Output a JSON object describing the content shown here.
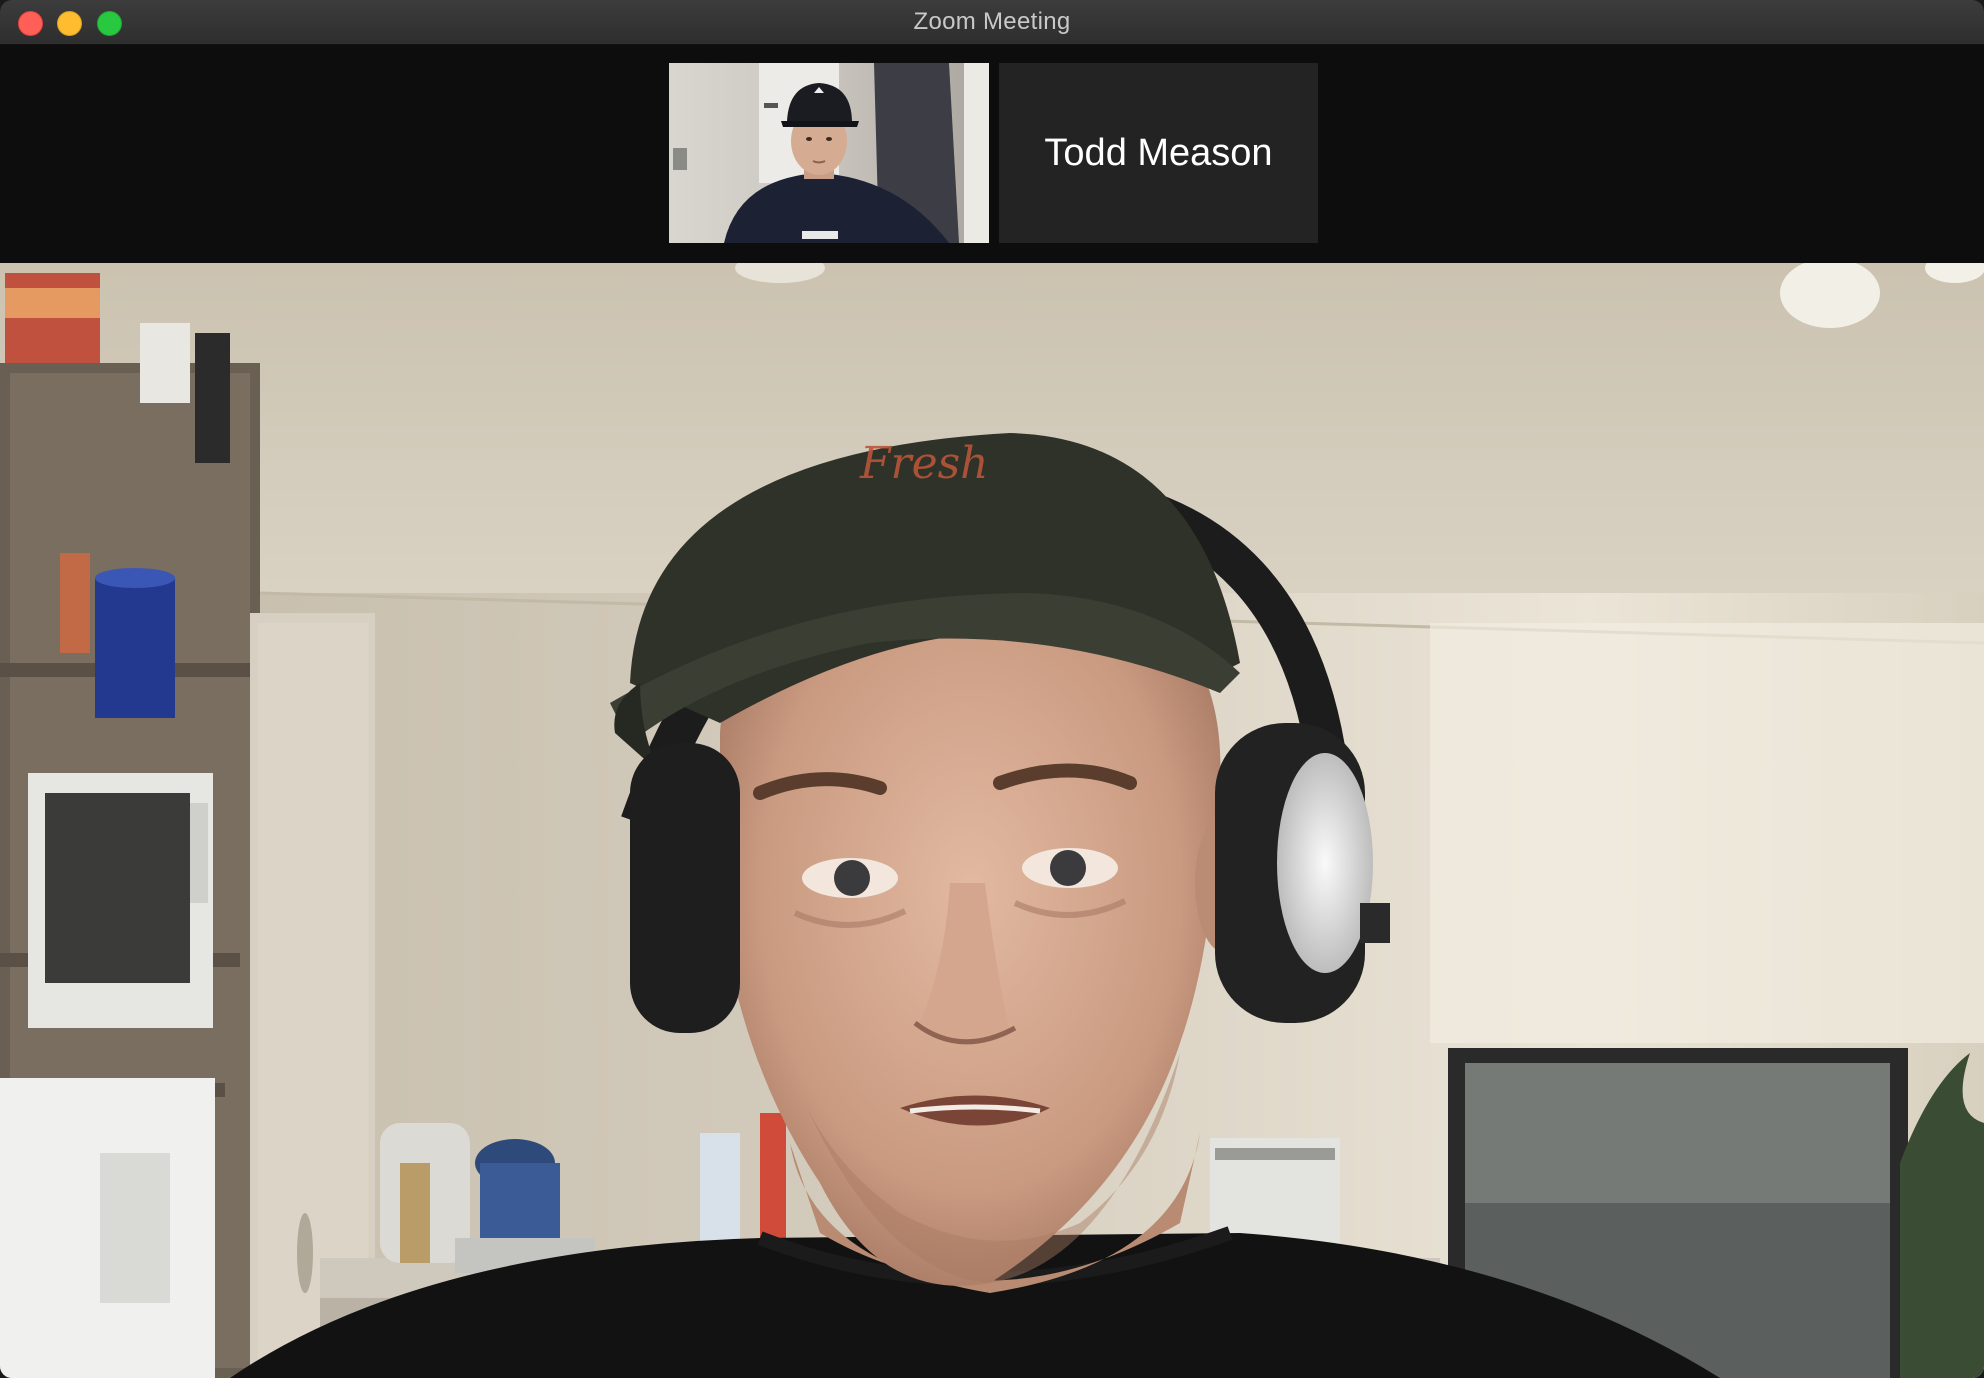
{
  "window": {
    "title": "Zoom Meeting"
  },
  "titlebar": {
    "buttons": [
      "close",
      "minimize",
      "zoom"
    ],
    "colors": {
      "close": "#ff5f57",
      "minimize": "#febc2e",
      "zoom": "#28c840"
    }
  },
  "participants_strip": {
    "tiles": [
      {
        "type": "video"
      },
      {
        "type": "name",
        "name": "Todd Meason"
      }
    ]
  },
  "active_speaker": {
    "type": "video"
  },
  "colors": {
    "background": "#0d0d0d",
    "name_tile": "#232323",
    "name_text": "#ffffff"
  }
}
